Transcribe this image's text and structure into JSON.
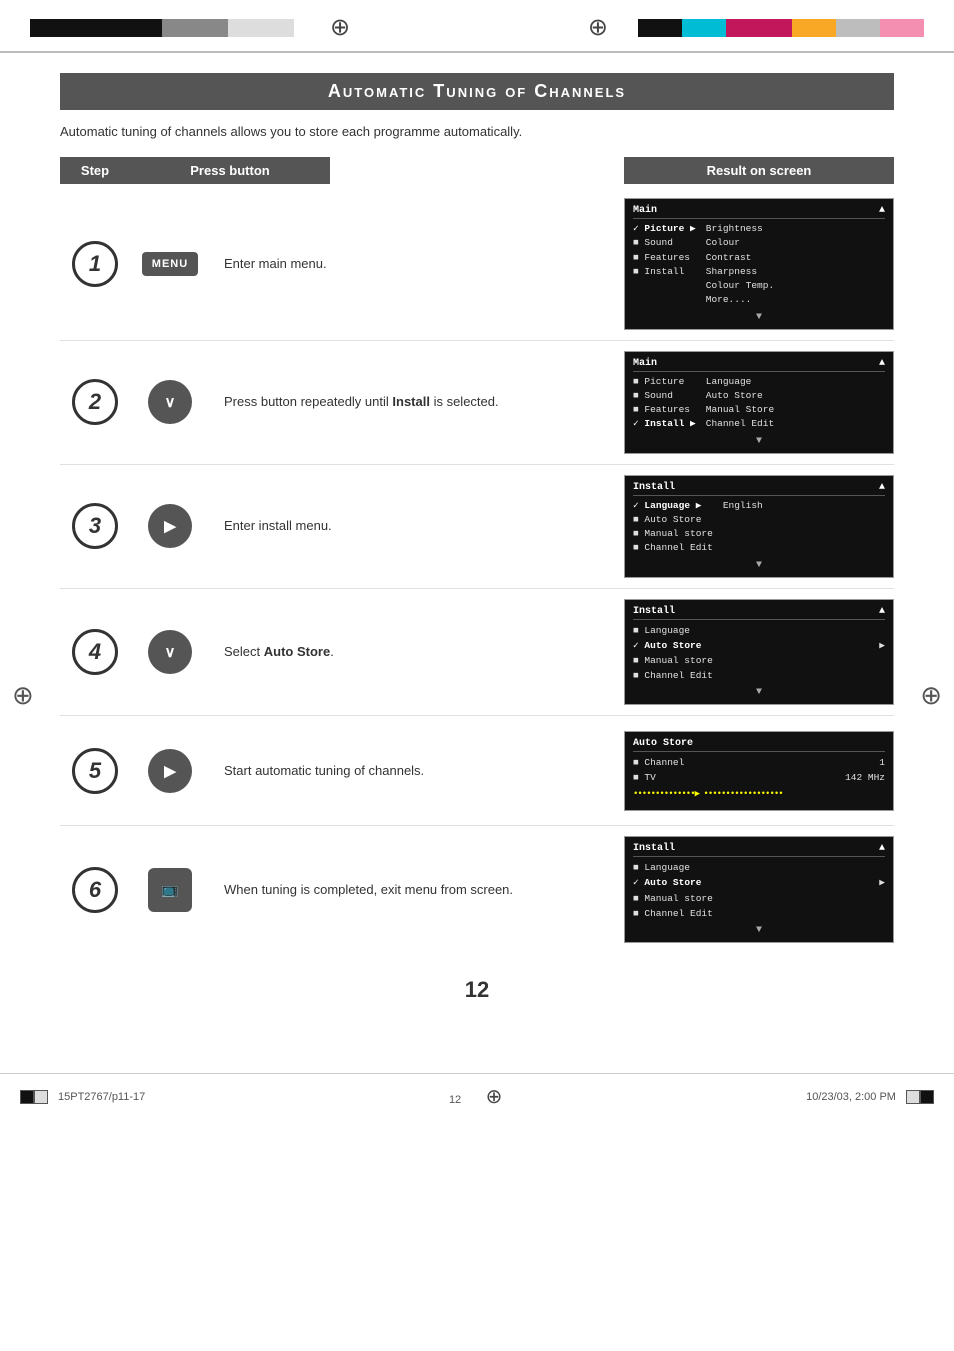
{
  "page": {
    "title": "Automatic Tuning of Channels",
    "subtitle": "Automatic tuning of channels allows you to store each programme automatically.",
    "page_number": "12",
    "file_ref": "15PT2767/p11-17",
    "page_ref": "12",
    "date_ref": "10/23/03, 2:00 PM"
  },
  "header": {
    "step_label": "Step",
    "press_label": "Press button",
    "result_label": "Result on screen"
  },
  "steps": [
    {
      "num": "1",
      "button": "MENU",
      "button_type": "menu",
      "description": "Enter main menu.",
      "screen": {
        "type": "menu1",
        "title": "Main",
        "items": [
          {
            "label": "✓ Picture",
            "sub": "Brightness"
          },
          {
            "label": "■ Sound",
            "sub": "Colour"
          },
          {
            "label": "■ Features",
            "sub": "Contrast"
          },
          {
            "label": "■ Install",
            "sub": "Sharpness"
          },
          {
            "label": "",
            "sub": "Colour Temp."
          },
          {
            "label": "",
            "sub": "More...."
          }
        ]
      }
    },
    {
      "num": "2",
      "button": "∨",
      "button_type": "circle",
      "description": "Press button repeatedly until Install is selected.",
      "description_bold": "Install",
      "screen": {
        "type": "menu2",
        "title": "Main",
        "items": [
          {
            "label": "■ Picture",
            "sub": "Language"
          },
          {
            "label": "■ Sound",
            "sub": "Auto Store"
          },
          {
            "label": "■ Features",
            "sub": "Manual Store"
          },
          {
            "label": "✓ Install ▶",
            "sub": "Channel Edit"
          }
        ]
      }
    },
    {
      "num": "3",
      "button": "▶",
      "button_type": "circle",
      "description": "Enter install menu.",
      "screen": {
        "type": "menu3",
        "title": "Install",
        "items": [
          {
            "label": "✓ Language ▶",
            "sub": "English"
          },
          {
            "label": "■ Auto Store",
            "sub": ""
          },
          {
            "label": "■ Manual store",
            "sub": ""
          },
          {
            "label": "■ Channel Edit",
            "sub": ""
          }
        ]
      }
    },
    {
      "num": "4",
      "button": "∨",
      "button_type": "circle",
      "description": "Select Auto Store.",
      "description_bold": "Auto Store",
      "screen": {
        "type": "menu4",
        "title": "Install",
        "items": [
          {
            "label": "■ Language",
            "sub": ""
          },
          {
            "label": "✓ Auto Store",
            "sub": "▶"
          },
          {
            "label": "■ Manual store",
            "sub": ""
          },
          {
            "label": "■ Channel Edit",
            "sub": ""
          }
        ]
      }
    },
    {
      "num": "5",
      "button": "▶",
      "button_type": "circle",
      "description": "Start automatic tuning of channels.",
      "screen": {
        "type": "autostore",
        "title": "Auto Store",
        "items": [
          {
            "label": "■ Channel",
            "sub": "1"
          },
          {
            "label": "■ TV",
            "sub": "142 MHz"
          }
        ],
        "progress": "••••••••••••••▶ ••••••••••••••••••"
      }
    },
    {
      "num": "6",
      "button": "TV",
      "button_type": "tv",
      "description": "When tuning is completed, exit menu from screen.",
      "screen": {
        "type": "menu5",
        "title": "Install",
        "items": [
          {
            "label": "■ Language",
            "sub": ""
          },
          {
            "label": "✓ Auto Store",
            "sub": "▶"
          },
          {
            "label": "■ Manual store",
            "sub": ""
          },
          {
            "label": "■ Channel Edit",
            "sub": ""
          }
        ]
      }
    }
  ],
  "colors": {
    "black": "#111111",
    "dark_gray": "#555555",
    "medium_gray": "#888888",
    "light_gray": "#cccccc",
    "white": "#ffffff",
    "cyan": "#00bcd4",
    "magenta": "#c2185b",
    "yellow": "#f9a825",
    "pink": "#f48fb1",
    "red": "#d32f2f",
    "green": "#388e3c",
    "blue": "#1565c0"
  }
}
